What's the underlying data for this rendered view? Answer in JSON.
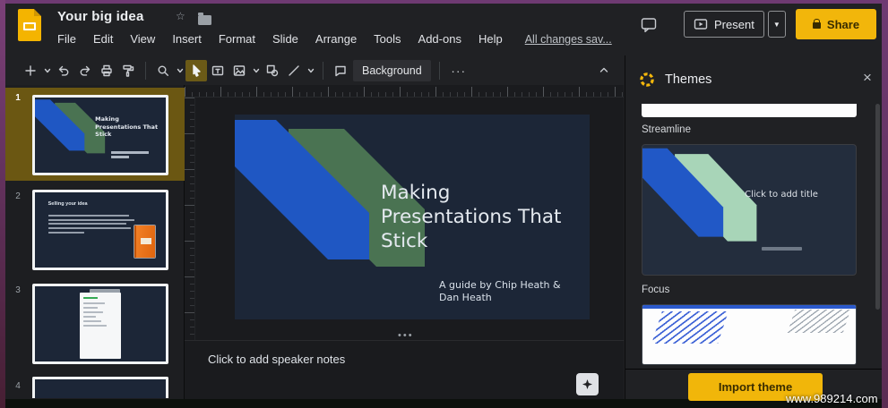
{
  "header": {
    "doc_title": "Your big idea",
    "menus": [
      "File",
      "Edit",
      "View",
      "Insert",
      "Format",
      "Slide",
      "Arrange",
      "Tools",
      "Add-ons",
      "Help"
    ],
    "save_status": "All changes sav...",
    "present_label": "Present",
    "share_label": "Share"
  },
  "toolbar": {
    "background_label": "Background",
    "more_label": "···"
  },
  "filmstrip": {
    "slides": [
      {
        "number": "1",
        "selected": true,
        "title": "Making Presentations That Stick",
        "subtitle": "A guide by Chip Heath & Dan Heath"
      },
      {
        "number": "2",
        "selected": false,
        "title": "Selling your idea"
      },
      {
        "number": "3",
        "selected": false,
        "title": ""
      },
      {
        "number": "4",
        "selected": false,
        "title": ""
      }
    ]
  },
  "slide": {
    "title_lines": [
      "Making",
      "Presentations That",
      "Stick"
    ],
    "subtitle_lines": [
      "A guide by Chip Heath &",
      "Dan Heath"
    ],
    "background_color": "#1c2637",
    "ribbon_blue": "#1f57c3",
    "ribbon_green": "#4a7352"
  },
  "notes": {
    "placeholder": "Click to add speaker notes"
  },
  "themes_panel": {
    "title": "Themes",
    "close_glyph": "×",
    "themes": [
      {
        "name": "Streamline",
        "preview_title": "Click to add title",
        "ribbon_blue": "#2158c6",
        "ribbon_mint": "#a8d5b8"
      },
      {
        "name": "Focus"
      }
    ],
    "import_button": "Import theme"
  },
  "watermark": "www.989214.com",
  "icons": {
    "app": "slides-logo",
    "header": [
      "star-icon",
      "folder-icon",
      "comments-icon",
      "present-icon",
      "lock-icon"
    ],
    "toolbar": [
      "new-slide-plus-icon",
      "undo-icon",
      "redo-icon",
      "print-icon",
      "paint-format-icon",
      "zoom-icon",
      "select-cursor-icon",
      "textbox-icon",
      "image-icon",
      "shape-icon",
      "line-icon",
      "comment-icon",
      "collapse-chevron-icon"
    ],
    "other": [
      "themes-palette-icon",
      "close-icon",
      "explore-icon",
      "drag-handle-dots"
    ]
  },
  "colors": {
    "accent_yellow": "#f1b60a",
    "selected_tool_olive": "#6b5a17",
    "frame_purple": "#6e3a72"
  }
}
